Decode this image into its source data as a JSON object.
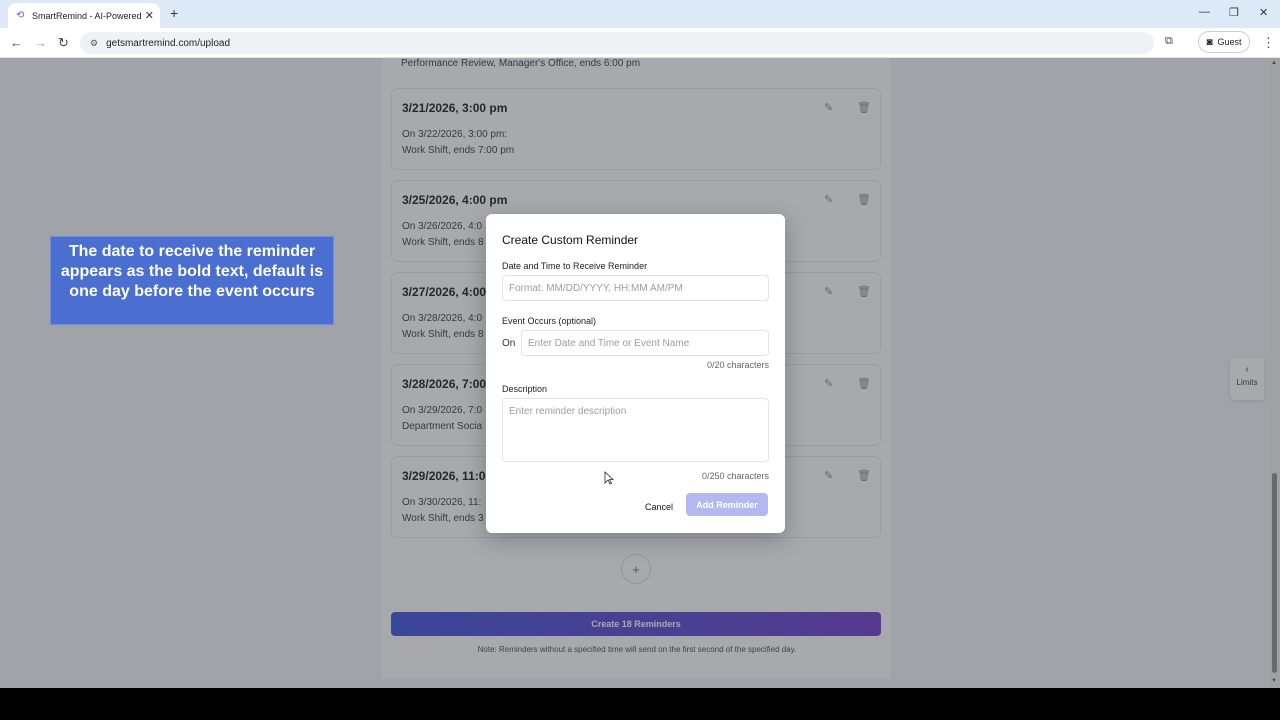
{
  "browser": {
    "tab_title": "SmartRemind - AI-Powered Do",
    "url": "getsmartremind.com/upload",
    "profile": "Guest"
  },
  "page": {
    "top_fragment": "Performance Review, Manager's Office, ends 6:00 pm",
    "cards": [
      {
        "date": "3/21/2026, 3:00 pm",
        "line1": "On 3/22/2026, 3:00 pm:",
        "line2": "Work Shift, ends 7:00 pm"
      },
      {
        "date": "3/25/2026, 4:00 pm",
        "line1": "On 3/26/2026, 4:0",
        "line2": "Work Shift, ends 8"
      },
      {
        "date": "3/27/2026, 4:00",
        "line1": "On 3/28/2026, 4:0",
        "line2": "Work Shift, ends 8"
      },
      {
        "date": "3/28/2026, 7:00",
        "line1": "On 3/29/2026, 7:0",
        "line2": "Department Socia"
      },
      {
        "date": "3/29/2026, 11:00",
        "line1": "On 3/30/2026, 11:",
        "line2": "Work Shift, ends 3"
      }
    ],
    "add_symbol": "+",
    "create_button": "Create 18 Reminders",
    "note": "Note: Reminders without a specified time will send on the first second of the specified day.",
    "limits_label": "Limits"
  },
  "callout": {
    "text": "The date to receive the reminder appears as the bold text, default is one day before the event occurs"
  },
  "modal": {
    "title": "Create Custom Reminder",
    "date_label": "Date and Time to Receive Reminder",
    "date_placeholder": "Format: MM/DD/YYYY, HH:MM AM/PM",
    "event_label": "Event Occurs (optional)",
    "on_label": "On",
    "event_placeholder": "Enter Date and Time or Event Name",
    "event_count": "0/20 characters",
    "desc_label": "Description",
    "desc_placeholder": "Enter reminder description",
    "desc_count": "0/250 characters",
    "cancel": "Cancel",
    "add": "Add Reminder"
  },
  "icons": {
    "edit": "pencil-icon",
    "delete": "trash-icon",
    "back": "arrow-left-icon",
    "forward": "arrow-right-icon",
    "reload": "reload-icon"
  }
}
